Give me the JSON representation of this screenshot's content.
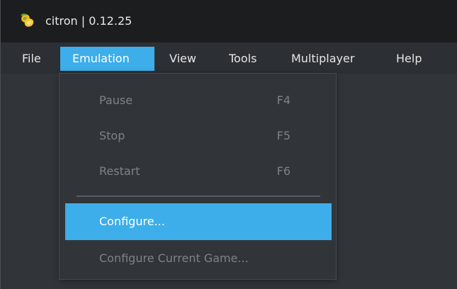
{
  "window": {
    "title": "citron | 0.12.25",
    "app_icon": "citron-logo-icon"
  },
  "menubar": {
    "items": [
      {
        "label": "File",
        "active": false
      },
      {
        "label": "Emulation",
        "active": true
      },
      {
        "label": "View",
        "active": false
      },
      {
        "label": "Tools",
        "active": false
      },
      {
        "label": "Multiplayer",
        "active": false
      },
      {
        "label": "Help",
        "active": false
      }
    ]
  },
  "emulation_menu": {
    "items": [
      {
        "label": "Pause",
        "shortcut": "F4",
        "enabled": false
      },
      {
        "label": "Stop",
        "shortcut": "F5",
        "enabled": false
      },
      {
        "label": "Restart",
        "shortcut": "F6",
        "enabled": false
      },
      {
        "label": "Configure...",
        "shortcut": "",
        "enabled": true,
        "highlighted": true
      },
      {
        "label": "Configure Current Game...",
        "shortcut": "",
        "enabled": false
      }
    ]
  },
  "colors": {
    "accent": "#3daee9",
    "titlebar": "#1c1d1f",
    "background": "#31353a",
    "disabled_text": "#7e8186",
    "text": "#e8e8e8"
  }
}
